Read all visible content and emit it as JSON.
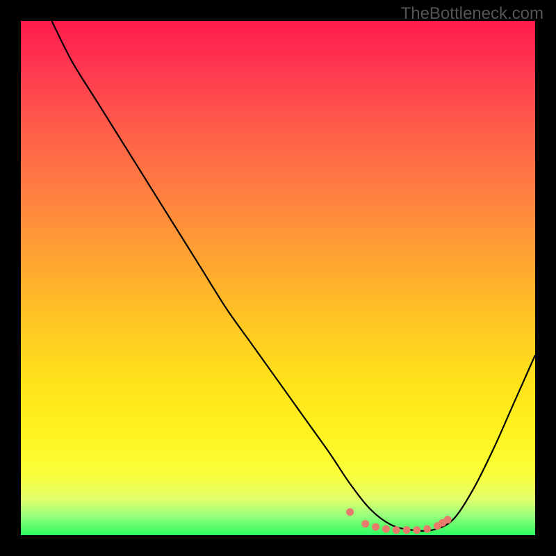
{
  "watermark": "TheBottleneck.com",
  "chart_data": {
    "type": "line",
    "title": "",
    "xlabel": "",
    "ylabel": "",
    "xlim": [
      0,
      100
    ],
    "ylim": [
      0,
      100
    ],
    "description": "Bottleneck compatibility curve on a rainbow gradient background. The black curve descends steeply from top-left, reaches a flat minimum around x≈68–82, then rises toward the right edge. Minimum region is highlighted with salmon markers.",
    "series": [
      {
        "name": "bottleneck-curve",
        "color": "#000000",
        "x": [
          6,
          10,
          15,
          20,
          25,
          30,
          35,
          40,
          45,
          50,
          55,
          60,
          64,
          68,
          72,
          76,
          80,
          84,
          88,
          92,
          96,
          100
        ],
        "y": [
          100,
          92,
          84,
          76,
          68,
          60,
          52,
          44,
          37,
          30,
          23,
          16,
          10,
          5,
          2,
          1,
          1,
          3,
          9,
          17,
          26,
          35
        ]
      }
    ],
    "highlight_points": {
      "color": "#e87a6c",
      "x": [
        64,
        67,
        69,
        71,
        73,
        75,
        77,
        79,
        81,
        82,
        83
      ],
      "y": [
        4.5,
        2.2,
        1.6,
        1.2,
        1.0,
        1.0,
        1.0,
        1.2,
        1.8,
        2.4,
        3.0
      ]
    }
  }
}
